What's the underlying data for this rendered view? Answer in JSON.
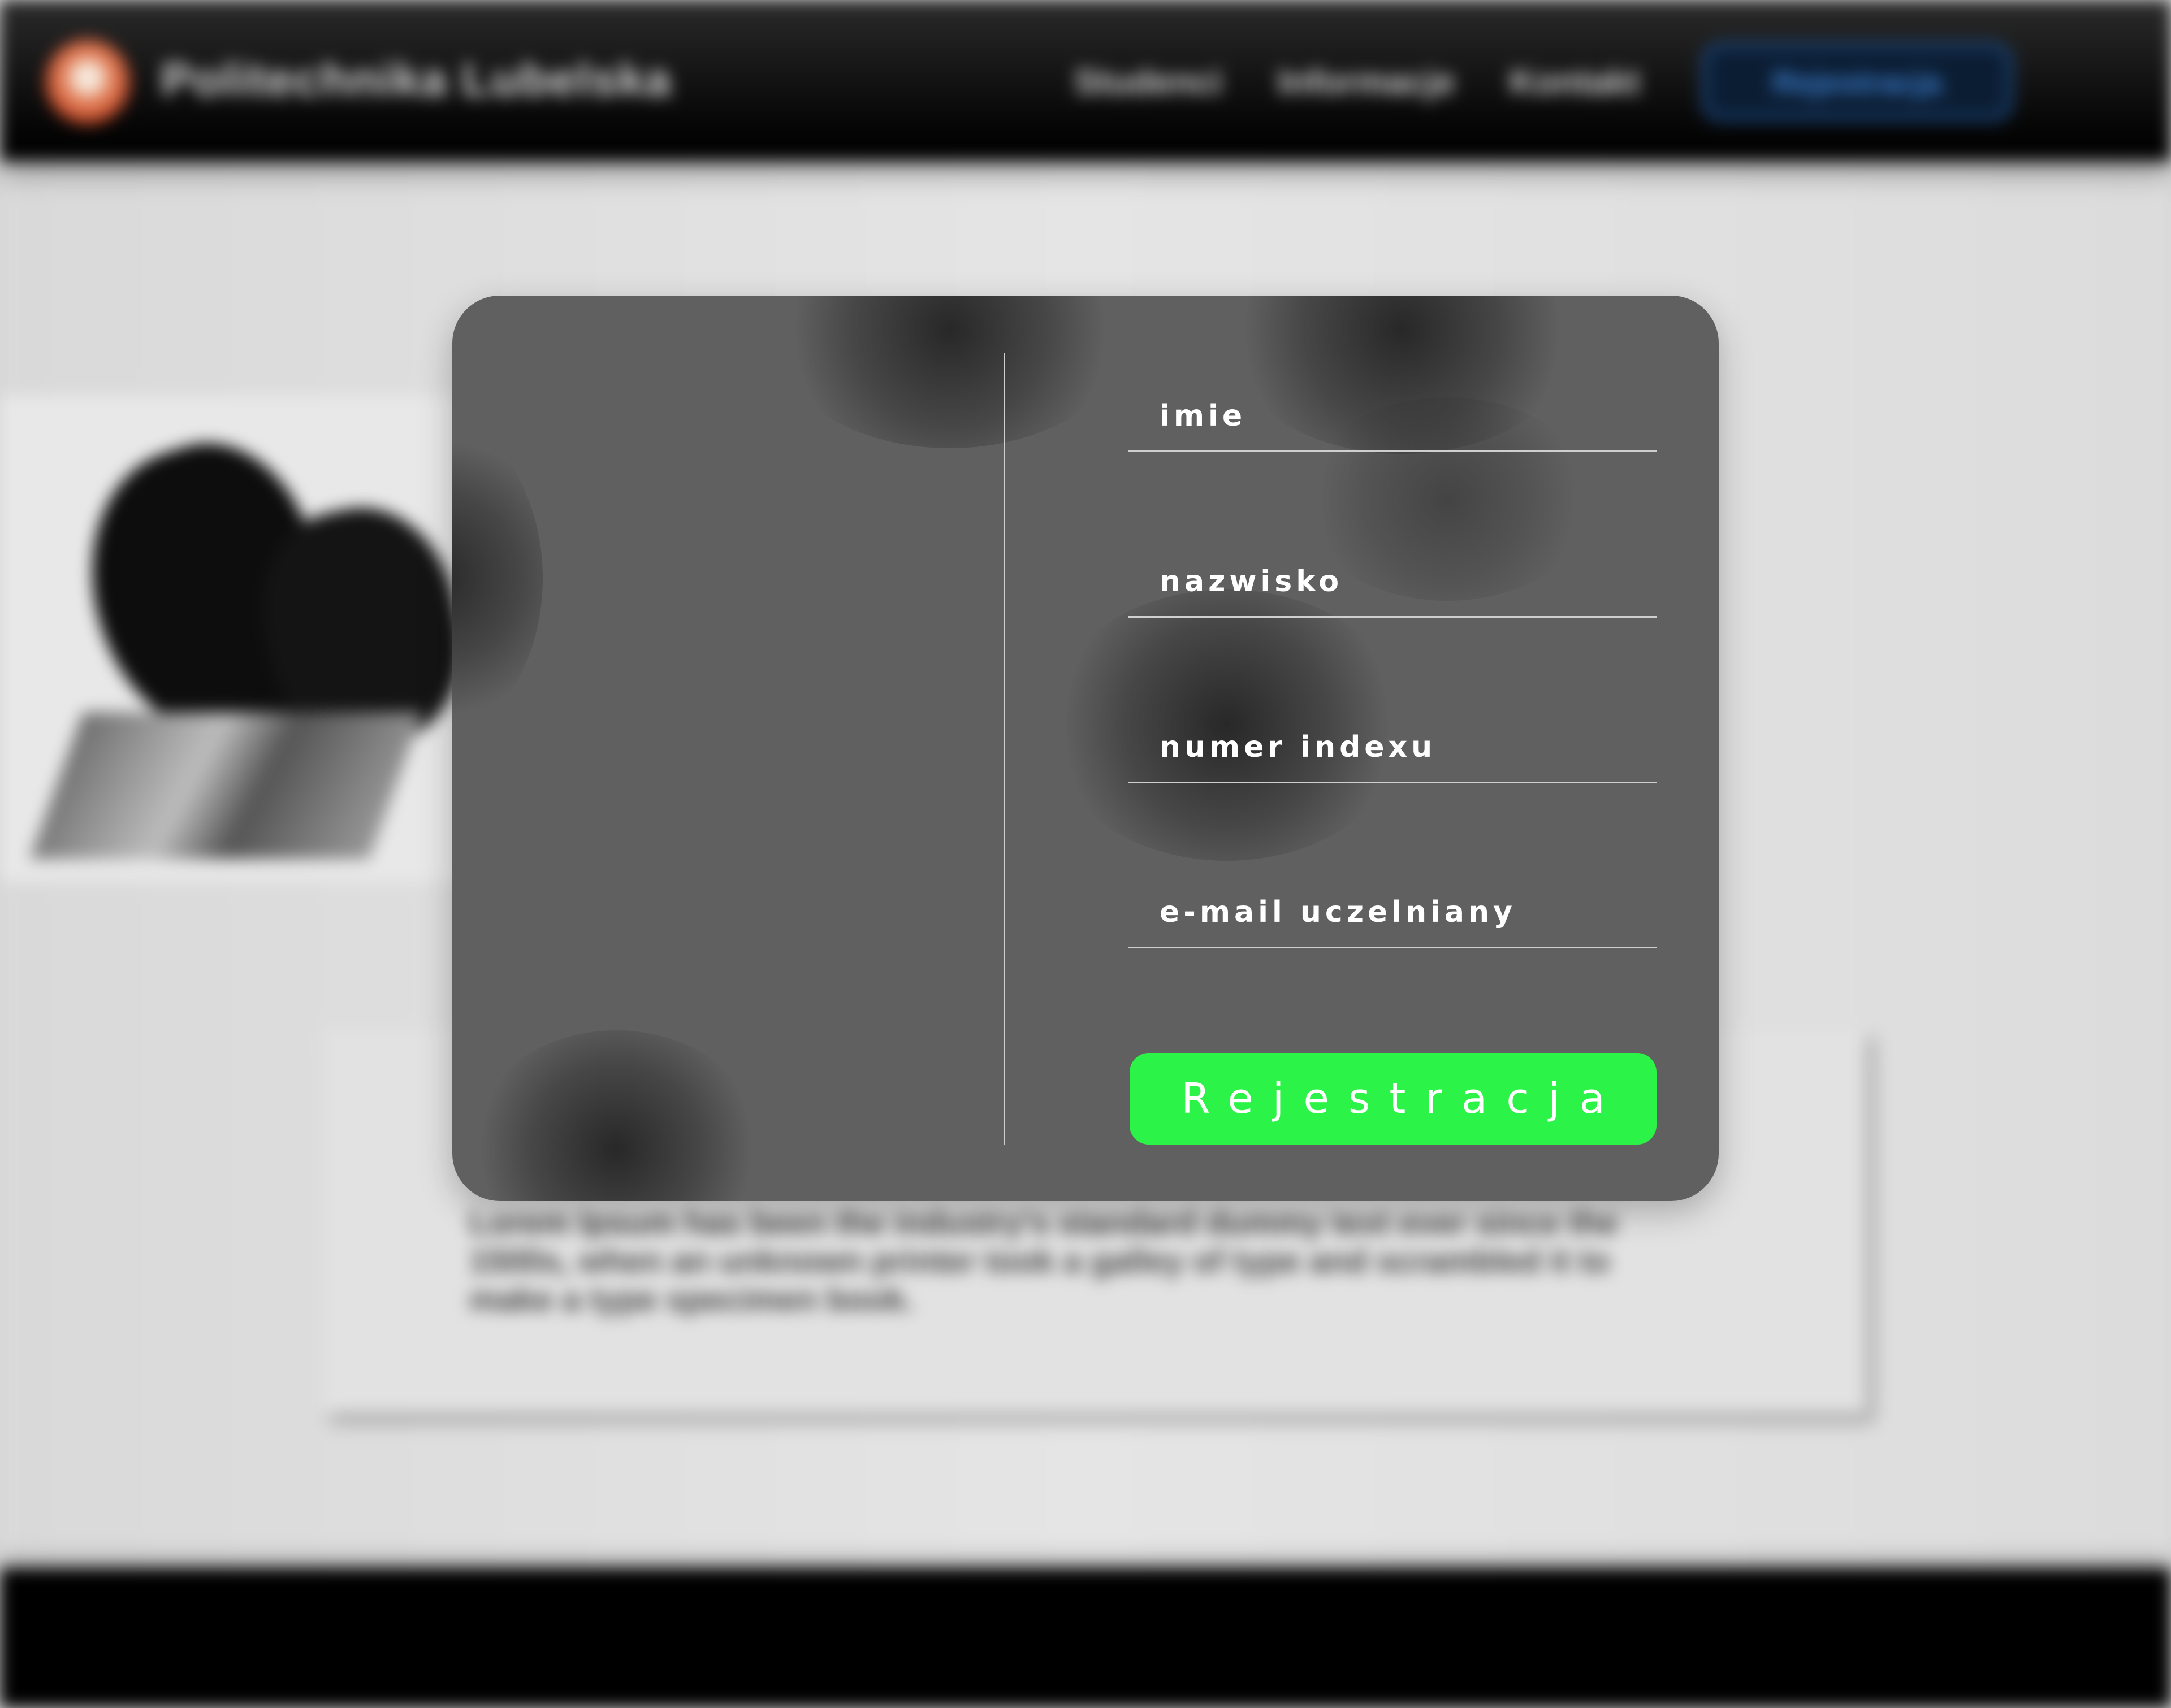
{
  "background": {
    "brand": "Politechnika Lubelska",
    "nav": [
      "Studenci",
      "Informacje",
      "Kontakt"
    ],
    "cta_label": "Rejestracja",
    "lorem": "Lorem Ipsum has been the industry's standard dummy text ever since the 1500s, when an unknown printer took a galley of type and scrambled it to make a type specimen book."
  },
  "form": {
    "fields": [
      {
        "placeholder": "imie"
      },
      {
        "placeholder": "nazwisko"
      },
      {
        "placeholder": "numer indexu"
      },
      {
        "placeholder": "e-mail uczelniany"
      }
    ],
    "submit_label": "Rejestracja"
  },
  "colors": {
    "submit": "#2cf347",
    "modal": "#606060",
    "header": "#000000"
  }
}
